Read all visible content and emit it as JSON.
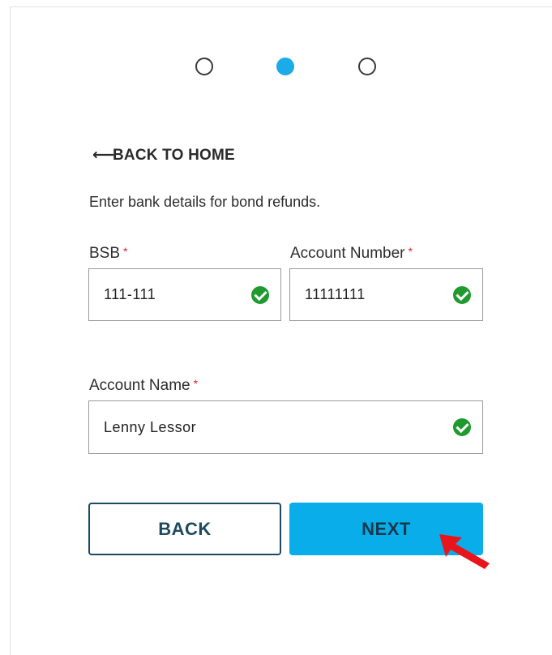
{
  "stepper": {
    "steps": [
      {
        "state": "inactive"
      },
      {
        "state": "active"
      },
      {
        "state": "inactive"
      }
    ],
    "active_color": "#1aabe8"
  },
  "nav": {
    "back_home_arrow": "⟵",
    "back_home_label": "BACK TO HOME"
  },
  "form": {
    "instruction": "Enter bank details for bond refunds.",
    "required_marker": "*",
    "bsb": {
      "label": "BSB",
      "value": "111-111",
      "valid": true
    },
    "account_number": {
      "label": "Account Number",
      "value": "11111111",
      "valid": true
    },
    "account_name": {
      "label": "Account Name",
      "value": "Lenny Lessor",
      "valid": true
    }
  },
  "actions": {
    "back_label": "BACK",
    "next_label": "NEXT"
  },
  "colors": {
    "valid_check": "#1f9a2e",
    "required": "#d9232d",
    "next_button": "#09ade9",
    "back_border": "#1d4a5e",
    "pointer_arrow": "#e8161c"
  }
}
